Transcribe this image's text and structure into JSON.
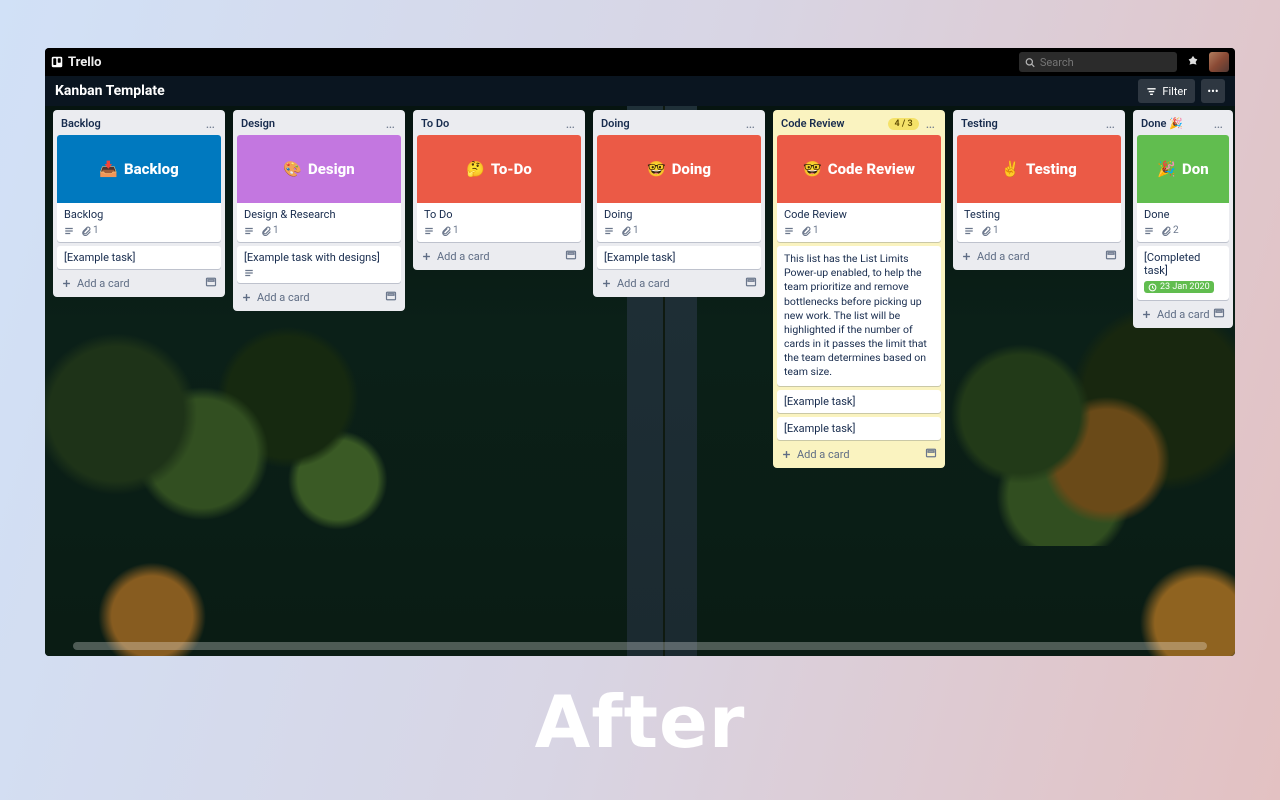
{
  "topbar": {
    "brand": "Trello",
    "search_placeholder": "Search"
  },
  "board": {
    "title": "Kanban Template",
    "filter_label": "Filter"
  },
  "common": {
    "add_card": "Add a card"
  },
  "lists": [
    {
      "title": "Backlog",
      "cover": {
        "emoji": "📥",
        "label": "Backlog",
        "color": "#0079bf"
      },
      "cover_card": {
        "title": "Backlog",
        "attach": "1"
      },
      "cards": [
        {
          "title": "[Example task]"
        }
      ],
      "show_footer": true
    },
    {
      "title": "Design",
      "cover": {
        "emoji": "🎨",
        "label": "Design",
        "color": "#c377e0"
      },
      "cover_card": {
        "title": "Design & Research",
        "attach": "1",
        "attach_only_desc": true
      },
      "cards": [
        {
          "title": "[Example task with designs]",
          "has_desc": true
        }
      ],
      "show_footer": true
    },
    {
      "title": "To Do",
      "cover": {
        "emoji": "🤔",
        "label": "To-Do",
        "color": "#eb5a46"
      },
      "cover_card": {
        "title": "To Do",
        "attach": "1"
      },
      "cards": [],
      "show_footer": true
    },
    {
      "title": "Doing",
      "cover": {
        "emoji": "🤓",
        "label": "Doing",
        "color": "#eb5a46"
      },
      "cover_card": {
        "title": "Doing",
        "attach": "1"
      },
      "cards": [
        {
          "title": "[Example task]"
        }
      ],
      "show_footer": true
    },
    {
      "title": "Code Review",
      "limit": "4 / 3",
      "highlight": true,
      "cover": {
        "emoji": "🤓",
        "label": "Code Review",
        "color": "#eb5a46"
      },
      "cover_card": {
        "title": "Code Review",
        "attach": "1"
      },
      "long_text": "This list has the List Limits Power-up enabled, to help the team prioritize and remove bottlenecks before picking up new work. The list will be highlighted if the number of cards in it passes the limit that the team determines based on team size.",
      "cards": [
        {
          "title": "[Example task]"
        },
        {
          "title": "[Example task]"
        }
      ],
      "show_footer": true
    },
    {
      "title": "Testing",
      "cover": {
        "emoji": "✌️",
        "label": "Testing",
        "color": "#eb5a46"
      },
      "cover_card": {
        "title": "Testing",
        "attach": "1"
      },
      "cards": [],
      "show_footer": true
    },
    {
      "title": "Done 🎉",
      "truncated": true,
      "cover": {
        "emoji": "🎉",
        "label": "Don",
        "color": "#61bd4f"
      },
      "cover_card": {
        "title": "Done",
        "attach": "2"
      },
      "cards": [
        {
          "title": "[Completed task]",
          "date": "23 Jan 2020"
        }
      ],
      "show_footer": true
    }
  ],
  "caption": "After"
}
